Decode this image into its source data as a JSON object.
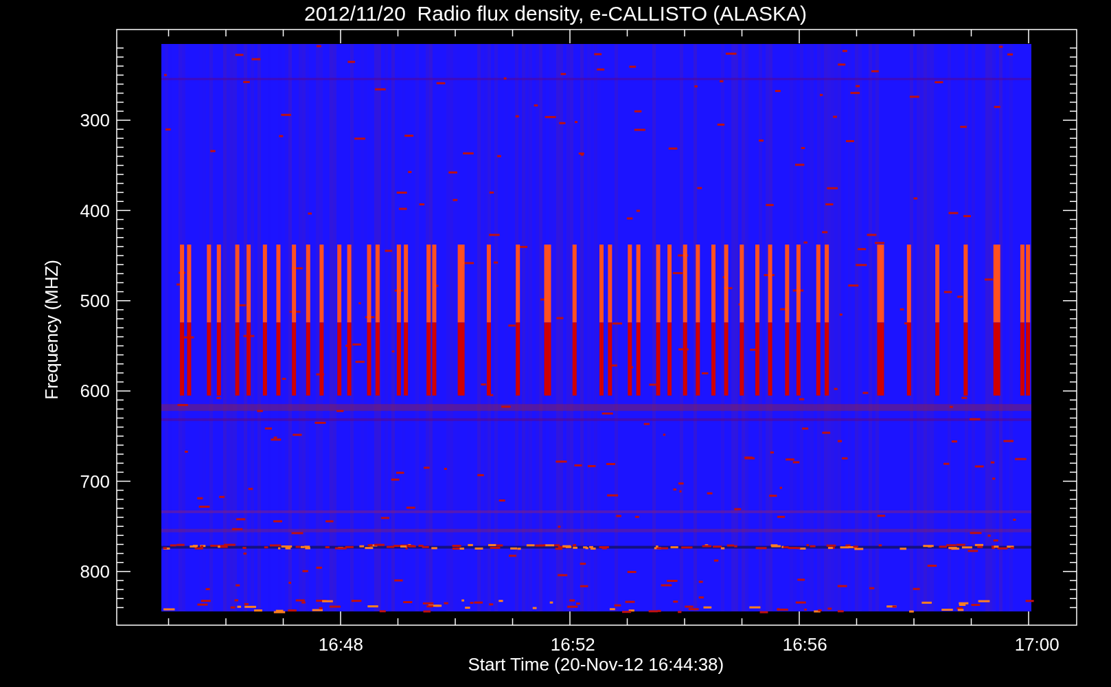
{
  "title": "2012/11/20  Radio flux density, e-CALLISTO (ALASKA)",
  "y_axis": {
    "label": "Frequency (MHZ)",
    "ticks": [
      "300",
      "400",
      "500",
      "600",
      "700",
      "800"
    ]
  },
  "x_axis": {
    "label": "Start Time (20-Nov-12 16:44:38)",
    "ticks": [
      "16:48",
      "16:52",
      "16:56",
      "17:00"
    ]
  }
}
